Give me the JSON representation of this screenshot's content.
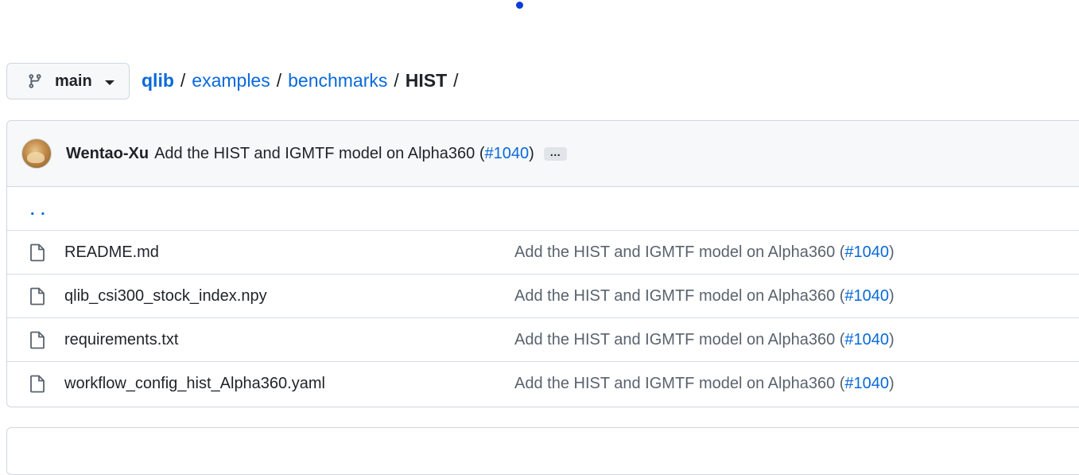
{
  "branch": {
    "icon": "git-branch-icon",
    "name": "main"
  },
  "breadcrumb": {
    "root": "qlib",
    "parts": [
      "examples",
      "benchmarks"
    ],
    "current": "HIST",
    "separator": "/"
  },
  "latest_commit": {
    "avatar": "user-avatar",
    "author": "Wentao-Xu",
    "message_prefix": "Add the HIST and IGMTF model on Alpha360 (",
    "pr_link": "#1040",
    "message_suffix": ")",
    "ellipsis": "…"
  },
  "parent_dir": {
    "label": ". ."
  },
  "files": [
    {
      "icon": "file-icon",
      "name": "README.md",
      "commit_prefix": "Add the HIST and IGMTF model on Alpha360 (",
      "commit_link": "#1040",
      "commit_suffix": ")"
    },
    {
      "icon": "file-icon",
      "name": "qlib_csi300_stock_index.npy",
      "commit_prefix": "Add the HIST and IGMTF model on Alpha360 (",
      "commit_link": "#1040",
      "commit_suffix": ")"
    },
    {
      "icon": "file-icon",
      "name": "requirements.txt",
      "commit_prefix": "Add the HIST and IGMTF model on Alpha360 (",
      "commit_link": "#1040",
      "commit_suffix": ")"
    },
    {
      "icon": "file-icon",
      "name": "workflow_config_hist_Alpha360.yaml",
      "commit_prefix": "Add the HIST and IGMTF model on Alpha360 (",
      "commit_link": "#1040",
      "commit_suffix": ")"
    }
  ],
  "colors": {
    "link": "#0969da",
    "text": "#1f2328",
    "muted": "#59636e",
    "border": "#d0d7de",
    "header_bg": "#f6f8fa",
    "loading_dot": "#0a3cd6"
  }
}
